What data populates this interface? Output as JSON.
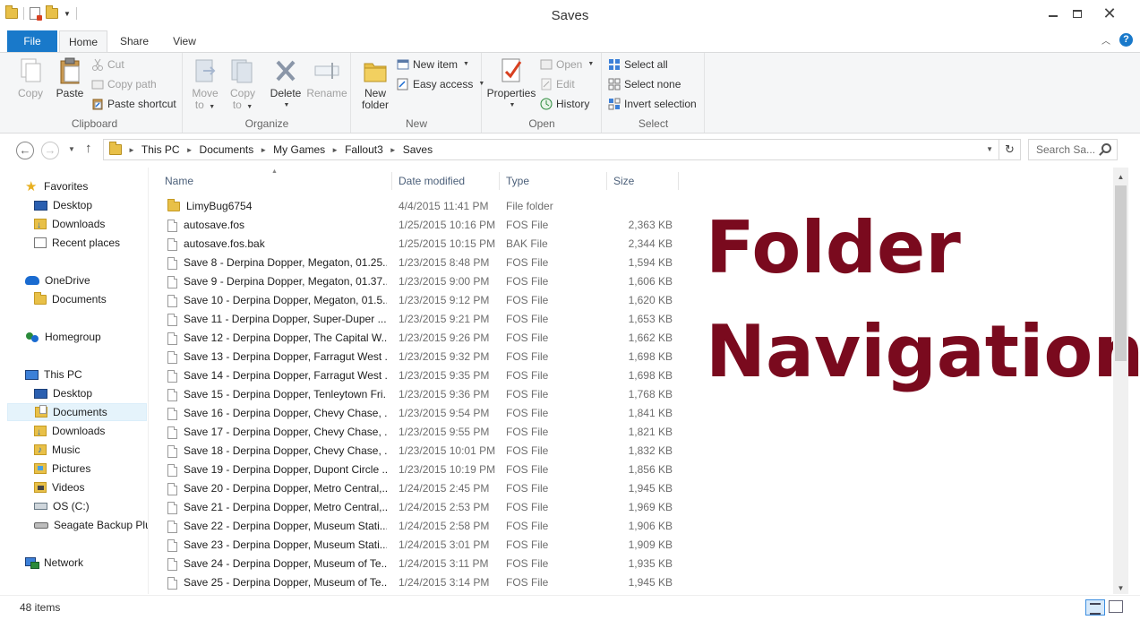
{
  "window": {
    "title": "Saves"
  },
  "ribbon_tabs": {
    "file": "File",
    "home": "Home",
    "share": "Share",
    "view": "View"
  },
  "ribbon": {
    "clipboard": {
      "label": "Clipboard",
      "copy": "Copy",
      "paste": "Paste",
      "cut": "Cut",
      "copy_path": "Copy path",
      "paste_shortcut": "Paste shortcut"
    },
    "organize": {
      "label": "Organize",
      "move_to_1": "Move",
      "move_to_2": "to",
      "copy_to_1": "Copy",
      "copy_to_2": "to",
      "delete": "Delete",
      "rename": "Rename"
    },
    "new": {
      "label": "New",
      "new_folder_1": "New",
      "new_folder_2": "folder",
      "new_item": "New item",
      "easy_access": "Easy access"
    },
    "open": {
      "label": "Open",
      "properties": "Properties",
      "open": "Open",
      "edit": "Edit",
      "history": "History"
    },
    "select": {
      "label": "Select",
      "select_all": "Select all",
      "select_none": "Select none",
      "invert_selection": "Invert selection"
    }
  },
  "address": {
    "crumbs": [
      "This PC",
      "Documents",
      "My Games",
      "Fallout3",
      "Saves"
    ],
    "search_placeholder": "Search Sa..."
  },
  "nav": {
    "favorites": "Favorites",
    "fav_desktop": "Desktop",
    "fav_downloads": "Downloads",
    "fav_recent": "Recent places",
    "onedrive": "OneDrive",
    "onedrive_documents": "Documents",
    "homegroup": "Homegroup",
    "thispc": "This PC",
    "pc_desktop": "Desktop",
    "pc_documents": "Documents",
    "pc_downloads": "Downloads",
    "pc_music": "Music",
    "pc_pictures": "Pictures",
    "pc_videos": "Videos",
    "pc_osc": "OS (C:)",
    "pc_seagate": "Seagate Backup Plus",
    "network": "Network"
  },
  "columns": {
    "name": "Name",
    "date": "Date modified",
    "type": "Type",
    "size": "Size"
  },
  "files": [
    {
      "name": "LimyBug6754",
      "date": "4/4/2015 11:41 PM",
      "type": "File folder",
      "size": ""
    },
    {
      "name": "autosave.fos",
      "date": "1/25/2015 10:16 PM",
      "type": "FOS File",
      "size": "2,363 KB"
    },
    {
      "name": "autosave.fos.bak",
      "date": "1/25/2015 10:15 PM",
      "type": "BAK File",
      "size": "2,344 KB"
    },
    {
      "name": "Save 8 - Derpina Dopper, Megaton, 01.25....",
      "date": "1/23/2015 8:48 PM",
      "type": "FOS File",
      "size": "1,594 KB"
    },
    {
      "name": "Save 9 - Derpina Dopper, Megaton, 01.37....",
      "date": "1/23/2015 9:00 PM",
      "type": "FOS File",
      "size": "1,606 KB"
    },
    {
      "name": "Save 10 - Derpina Dopper, Megaton, 01.5...",
      "date": "1/23/2015 9:12 PM",
      "type": "FOS File",
      "size": "1,620 KB"
    },
    {
      "name": "Save 11 - Derpina Dopper, Super-Duper ...",
      "date": "1/23/2015 9:21 PM",
      "type": "FOS File",
      "size": "1,653 KB"
    },
    {
      "name": "Save 12 - Derpina Dopper, The Capital W...",
      "date": "1/23/2015 9:26 PM",
      "type": "FOS File",
      "size": "1,662 KB"
    },
    {
      "name": "Save 13 - Derpina Dopper, Farragut West ...",
      "date": "1/23/2015 9:32 PM",
      "type": "FOS File",
      "size": "1,698 KB"
    },
    {
      "name": "Save 14 - Derpina Dopper, Farragut West ...",
      "date": "1/23/2015 9:35 PM",
      "type": "FOS File",
      "size": "1,698 KB"
    },
    {
      "name": "Save 15 - Derpina Dopper, Tenleytown Fri...",
      "date": "1/23/2015 9:36 PM",
      "type": "FOS File",
      "size": "1,768 KB"
    },
    {
      "name": "Save 16 - Derpina Dopper, Chevy Chase, ...",
      "date": "1/23/2015 9:54 PM",
      "type": "FOS File",
      "size": "1,841 KB"
    },
    {
      "name": "Save 17 - Derpina Dopper, Chevy Chase, ...",
      "date": "1/23/2015 9:55 PM",
      "type": "FOS File",
      "size": "1,821 KB"
    },
    {
      "name": "Save 18 - Derpina Dopper, Chevy Chase, ...",
      "date": "1/23/2015 10:01 PM",
      "type": "FOS File",
      "size": "1,832 KB"
    },
    {
      "name": "Save 19 - Derpina Dopper, Dupont Circle ...",
      "date": "1/23/2015 10:19 PM",
      "type": "FOS File",
      "size": "1,856 KB"
    },
    {
      "name": "Save 20 - Derpina Dopper, Metro Central,...",
      "date": "1/24/2015 2:45 PM",
      "type": "FOS File",
      "size": "1,945 KB"
    },
    {
      "name": "Save 21 - Derpina Dopper, Metro Central,...",
      "date": "1/24/2015 2:53 PM",
      "type": "FOS File",
      "size": "1,969 KB"
    },
    {
      "name": "Save 22 - Derpina Dopper, Museum Stati...",
      "date": "1/24/2015 2:58 PM",
      "type": "FOS File",
      "size": "1,906 KB"
    },
    {
      "name": "Save 23 - Derpina Dopper, Museum Stati...",
      "date": "1/24/2015 3:01 PM",
      "type": "FOS File",
      "size": "1,909 KB"
    },
    {
      "name": "Save 24 - Derpina Dopper, Museum of Te...",
      "date": "1/24/2015 3:11 PM",
      "type": "FOS File",
      "size": "1,935 KB"
    },
    {
      "name": "Save 25 - Derpina Dopper, Museum of Te...",
      "date": "1/24/2015 3:14 PM",
      "type": "FOS File",
      "size": "1,945 KB"
    }
  ],
  "overlay": {
    "line1": "Folder",
    "line2": "Navigation"
  },
  "status": {
    "item_count": "48 items"
  },
  "colors": {
    "accent": "#1979ca",
    "overlay_text": "#7a0a1e",
    "ribbon_bg": "#f5f6f7"
  }
}
